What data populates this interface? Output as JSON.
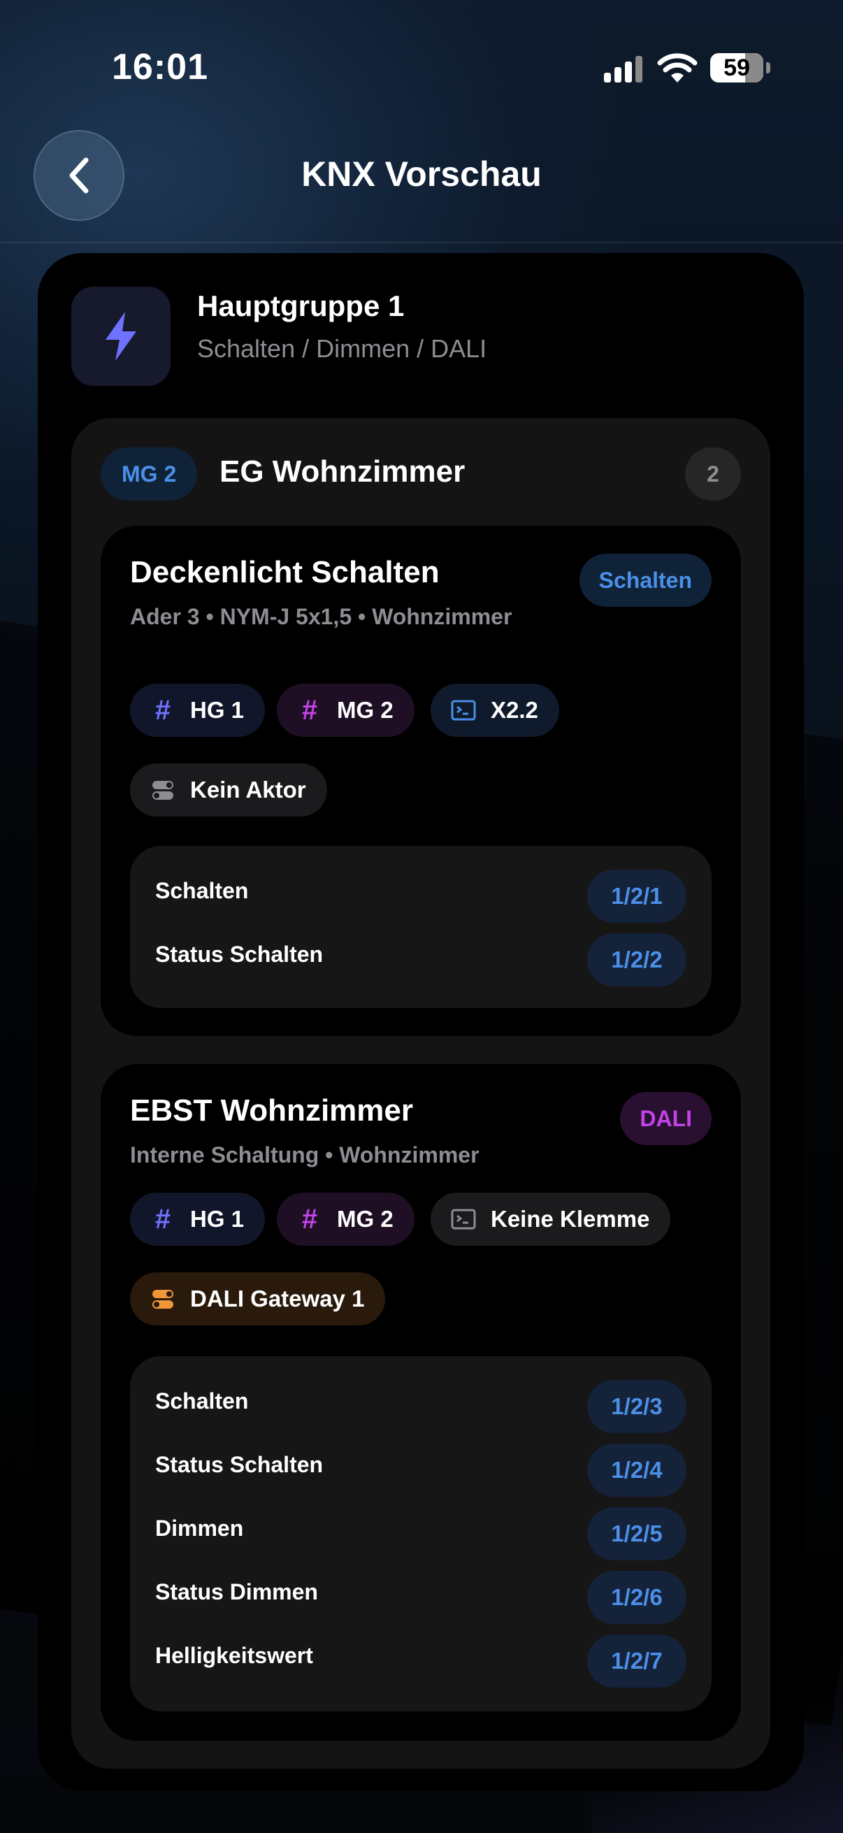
{
  "status_bar": {
    "time": "16:01",
    "battery": "59"
  },
  "nav": {
    "title": "KNX Vorschau"
  },
  "hauptgruppe": {
    "title": "Hauptgruppe 1",
    "subtitle": "Schalten / Dimmen / DALI",
    "icon": "bolt-icon"
  },
  "mittelgruppe": {
    "badge": "MG 2",
    "title": "EG Wohnzimmer",
    "count": "2"
  },
  "functions": [
    {
      "title": "Deckenlicht Schalten",
      "subtitle": "Ader 3 • NYM-J 5x1,5 • Wohnzimmer",
      "type": "Schalten",
      "chips": {
        "hg": "HG 1",
        "mg": "MG 2",
        "terminal": "X2.2",
        "actor": "Kein Aktor"
      },
      "addresses": [
        {
          "label": "Schalten",
          "value": "1/2/1"
        },
        {
          "label": "Status Schalten",
          "value": "1/2/2"
        }
      ]
    },
    {
      "title": "EBST Wohnzimmer",
      "subtitle": "Interne Schaltung • Wohnzimmer",
      "type": "DALI",
      "chips": {
        "hg": "HG 1",
        "mg": "MG 2",
        "terminal": "Keine Klemme",
        "actor": "DALI Gateway 1"
      },
      "addresses": [
        {
          "label": "Schalten",
          "value": "1/2/3"
        },
        {
          "label": "Status Schalten",
          "value": "1/2/4"
        },
        {
          "label": "Dimmen",
          "value": "1/2/5"
        },
        {
          "label": "Status Dimmen",
          "value": "1/2/6"
        },
        {
          "label": "Helligkeitswert",
          "value": "1/2/7"
        }
      ]
    }
  ],
  "colors": {
    "accent_blue": "#4b8fe8",
    "dali_purple": "#c243e6",
    "hg_icon_blue": "#6f72ff",
    "mg_icon_magenta": "#c243e6",
    "gateway_orange": "#f0953a"
  }
}
